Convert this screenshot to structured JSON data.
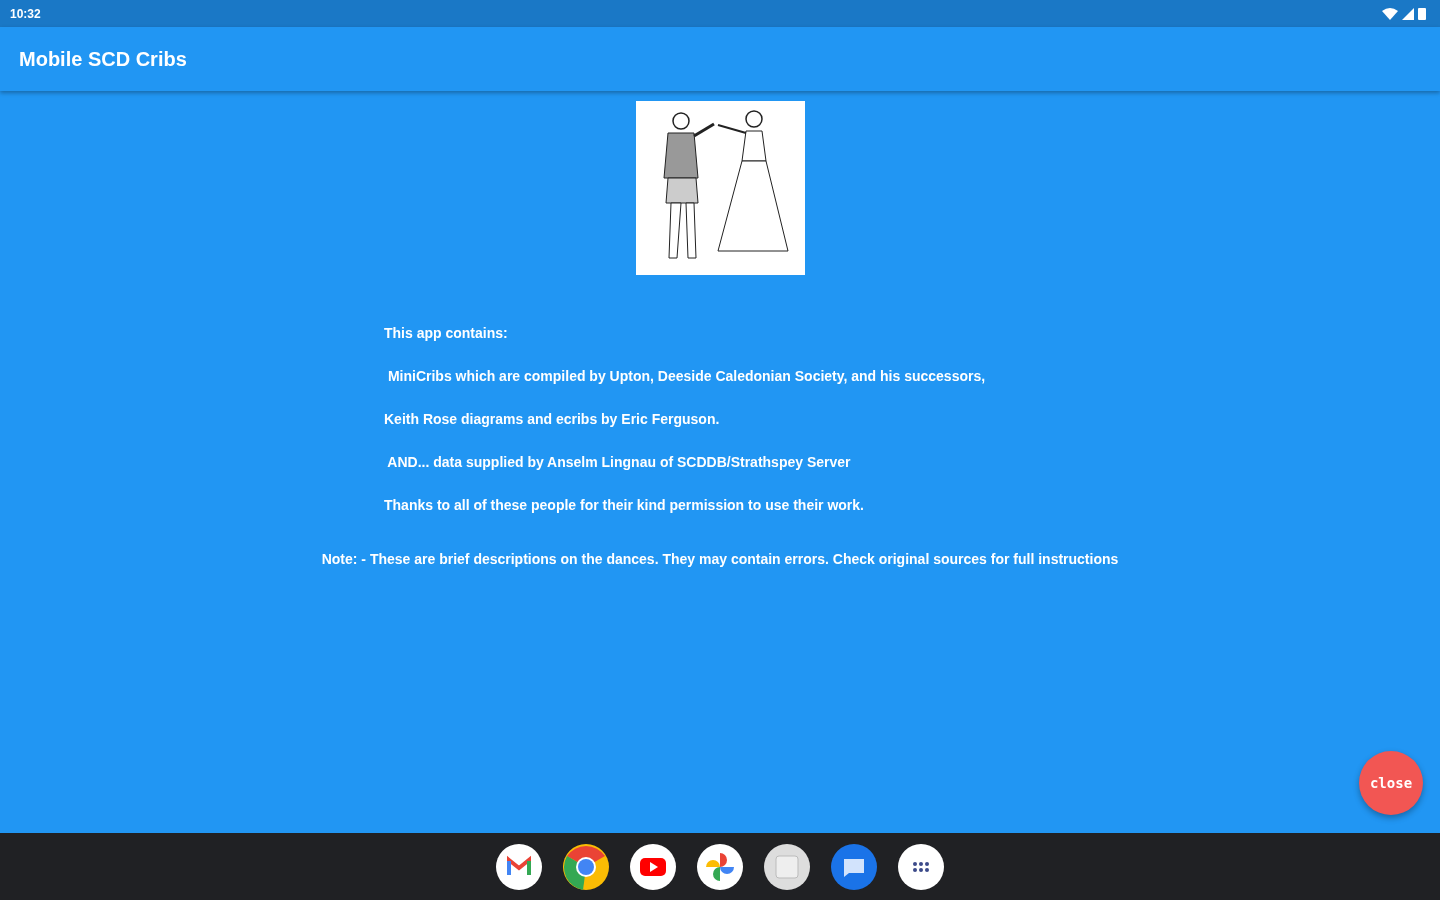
{
  "status_bar": {
    "time": "10:32"
  },
  "app_bar": {
    "title": "Mobile SCD Cribs"
  },
  "content": {
    "lines": [
      "This app contains:",
      " MiniCribs which are compiled by Upton, Deeside Caledonian Society, and his successors,",
      "Keith Rose diagrams and ecribs by Eric Ferguson.",
      " AND... data supplied by Anselm Lingnau of SCDDB/Strathspey Server",
      "Thanks to all of these people for their kind permission to use their work."
    ],
    "note": "Note: - These are brief descriptions on the dances. They may contain errors. Check original sources for full instructions"
  },
  "fab": {
    "label": "close"
  },
  "taskbar": {
    "apps": [
      {
        "kind": "mail"
      },
      {
        "kind": "browser"
      },
      {
        "kind": "video"
      },
      {
        "kind": "photos"
      },
      {
        "kind": "gallery"
      },
      {
        "kind": "chat"
      },
      {
        "kind": "launcher"
      }
    ]
  }
}
